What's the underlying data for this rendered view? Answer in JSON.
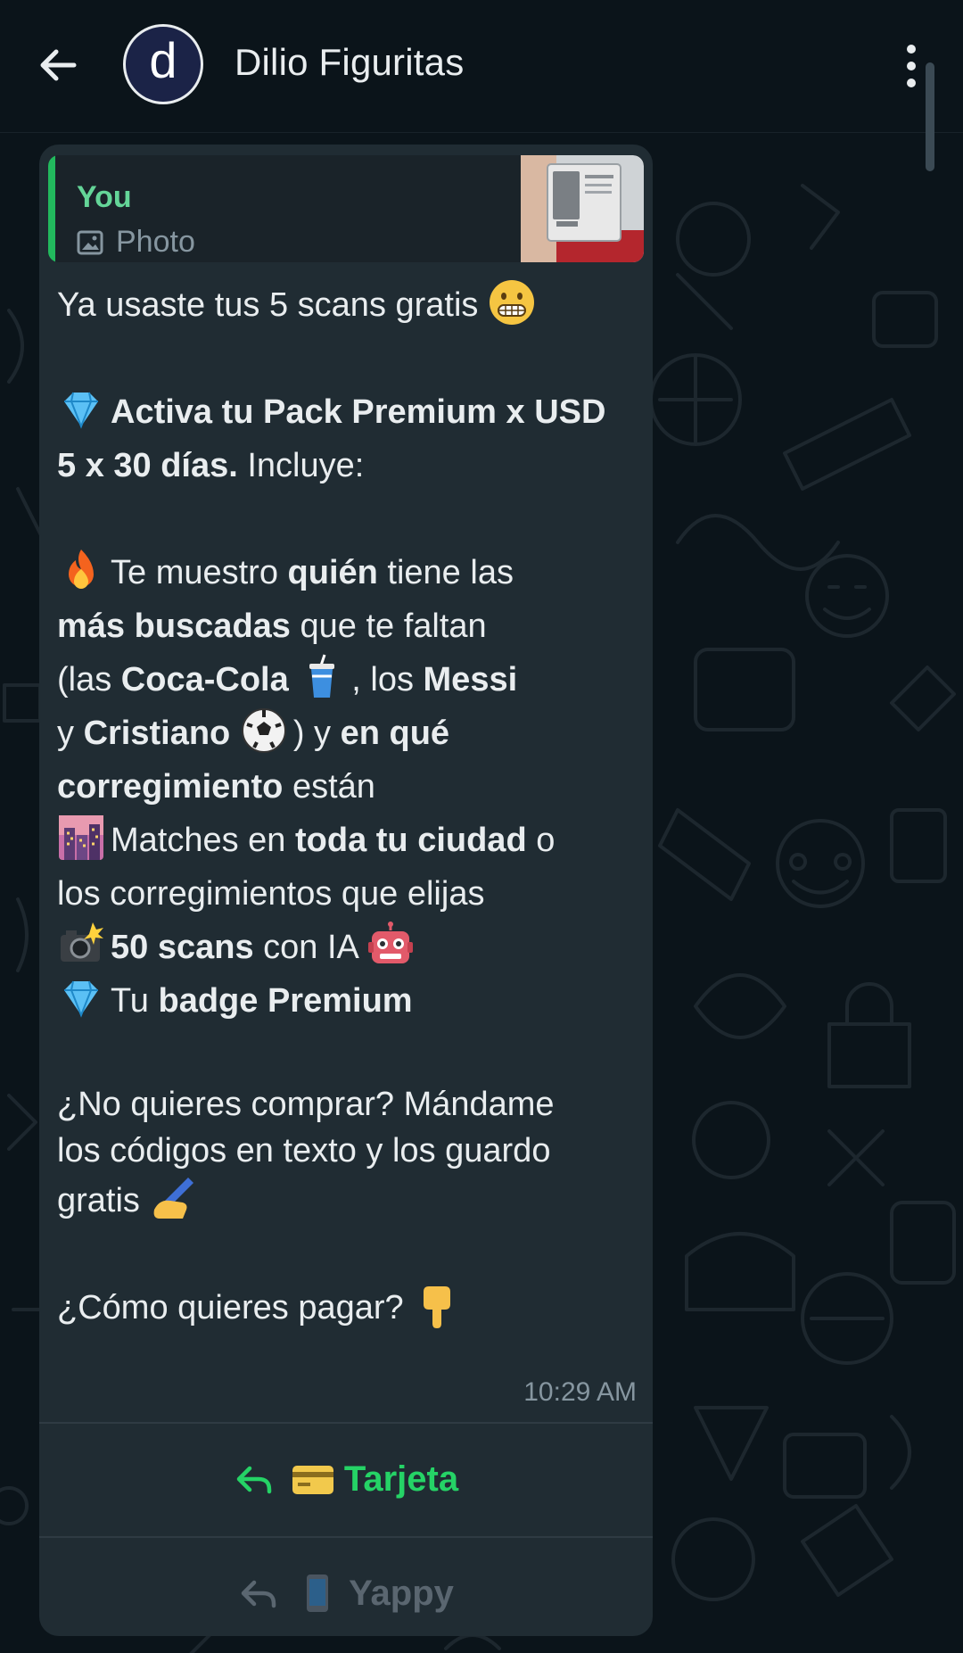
{
  "header": {
    "contact_name": "Dilio Figuritas",
    "avatar_letter": "d",
    "icons": {
      "back": "arrow-left-icon",
      "menu": "more-vertical-icon"
    }
  },
  "message": {
    "quoted": {
      "author": "You",
      "type_label": "Photo",
      "icon": "photo-icon"
    },
    "lines": {
      "l1": "Ya usaste tus 5 scans gratis",
      "l2_bold": "Activa tu Pack Premium x USD",
      "l3_bold": "5 x 30 días.",
      "l3_rest": " Incluye:",
      "l4_a": "Te muestro ",
      "l4_b": "quién",
      "l4_c": " tiene las",
      "l5_a": "más buscadas",
      "l5_b": " que te faltan",
      "l6_a": "(las ",
      "l6_b": "Coca-Cola",
      "l6_c": ", los ",
      "l6_d": "Messi",
      "l7_a": "y ",
      "l7_b": "Cristiano",
      "l7_c": ") y ",
      "l7_d": "en qué",
      "l8_a": "corregimiento",
      "l8_b": " están",
      "l9_a": "Matches en ",
      "l9_b": "toda tu ciudad",
      "l9_c": " o",
      "l10": "los corregimientos que elijas",
      "l11_a": "50 scans",
      "l11_b": " con IA",
      "l12_a": "Tu ",
      "l12_b": "badge Premium",
      "l13": "¿No quieres comprar? Mándame",
      "l14": "los códigos en texto y los guardo",
      "l15": "gratis",
      "l16": "¿Cómo quieres pagar?"
    },
    "time": "10:29 AM"
  },
  "quick_replies": [
    {
      "label": "Tarjeta",
      "state": "active",
      "icon": "credit-card-icon"
    },
    {
      "label": "Yappy",
      "state": "inactive",
      "icon": "mobile-phone-icon"
    }
  ],
  "colors": {
    "header_bg": "#0b141a",
    "bubble_bg": "#202c33",
    "accent_green": "#25d366",
    "muted_text": "#8696a0"
  }
}
